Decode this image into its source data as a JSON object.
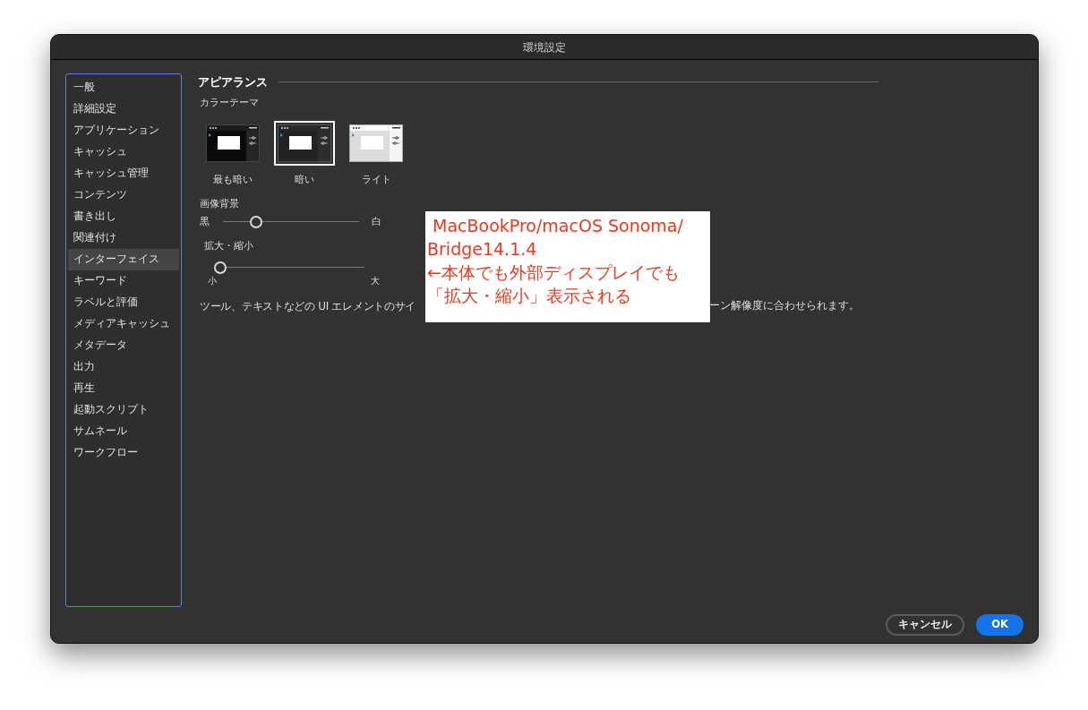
{
  "window": {
    "title": "環境設定"
  },
  "sidebar": {
    "items": [
      {
        "label": "一般",
        "selected": false
      },
      {
        "label": "詳細設定",
        "selected": false
      },
      {
        "label": "アプリケーション",
        "selected": false
      },
      {
        "label": "キャッシュ",
        "selected": false
      },
      {
        "label": "キャッシュ管理",
        "selected": false
      },
      {
        "label": "コンテンツ",
        "selected": false
      },
      {
        "label": "書き出し",
        "selected": false
      },
      {
        "label": "関連付け",
        "selected": false
      },
      {
        "label": "インターフェイス",
        "selected": true
      },
      {
        "label": "キーワード",
        "selected": false
      },
      {
        "label": "ラベルと評価",
        "selected": false
      },
      {
        "label": "メディアキャッシュ",
        "selected": false
      },
      {
        "label": "メタデータ",
        "selected": false
      },
      {
        "label": "出力",
        "selected": false
      },
      {
        "label": "再生",
        "selected": false
      },
      {
        "label": "起動スクリプト",
        "selected": false
      },
      {
        "label": "サムネール",
        "selected": false
      },
      {
        "label": "ワークフロー",
        "selected": false
      }
    ]
  },
  "section": {
    "title": "アピアランス",
    "color_theme": {
      "label": "カラーテーマ",
      "options": [
        {
          "kind": "darkest",
          "label": "最も暗い",
          "selected": false
        },
        {
          "kind": "dark",
          "label": "暗い",
          "selected": true
        },
        {
          "kind": "light",
          "label": "ライト",
          "selected": false
        }
      ]
    },
    "image_background": {
      "label": "画像背景",
      "min_label": "黒",
      "max_label": "白",
      "level": 0.22
    },
    "scale": {
      "label": "拡大・縮小",
      "min_label": "小",
      "max_label": "大",
      "level": 0.0
    },
    "description_left": "ツール、テキストなどの UI エレメントのサイ",
    "description_right": "ーン解像度に合わせられます。"
  },
  "annotation": {
    "lines": [
      " MacBookPro/macOS Sonoma/",
      "Bridge14.1.4",
      "←本体でも外部ディスプレイでも",
      "「拡大・縮小」表示される"
    ]
  },
  "buttons": [
    {
      "kind": "secondary",
      "label": "キャンセル"
    },
    {
      "kind": "primary",
      "label": "OK"
    }
  ]
}
